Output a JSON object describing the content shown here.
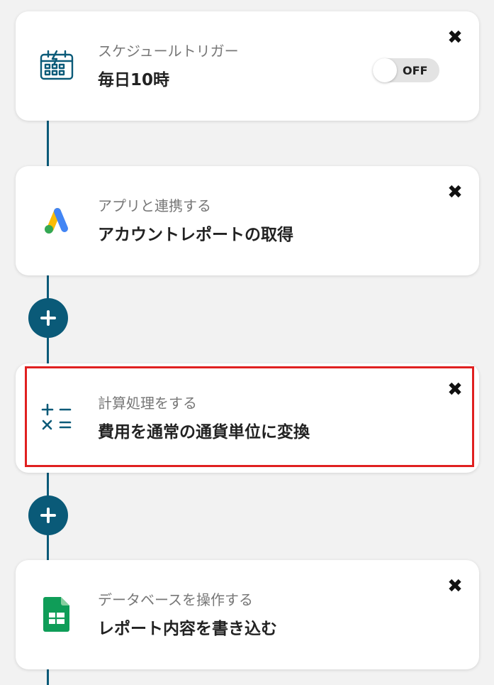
{
  "steps": [
    {
      "subtitle": "スケジュールトリガー",
      "title": "毎日10時",
      "icon": "calendar-lightning-icon",
      "toggle": {
        "label": "OFF",
        "on": false
      }
    },
    {
      "subtitle": "アプリと連携する",
      "title": "アカウントレポートの取得",
      "icon": "google-ads-icon"
    },
    {
      "subtitle": "計算処理をする",
      "title": "費用を通常の通貨単位に変換",
      "icon": "calculator-operators-icon",
      "highlighted": true
    },
    {
      "subtitle": "データベースを操作する",
      "title": "レポート内容を書き込む",
      "icon": "google-sheets-icon"
    }
  ],
  "colors": {
    "accent": "#0a5a78",
    "highlight": "#e02020",
    "background": "#f2f2f2"
  },
  "close_glyph": "✖"
}
